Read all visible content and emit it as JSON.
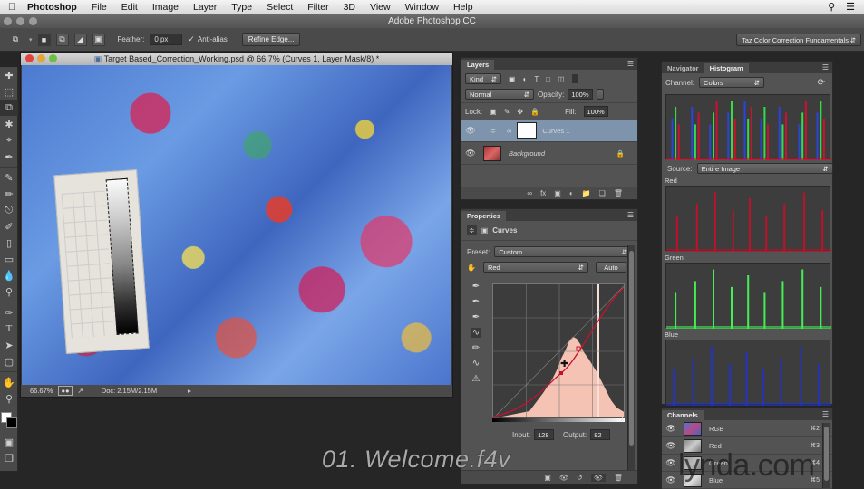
{
  "menubar": {
    "app": "Photoshop",
    "items": [
      "File",
      "Edit",
      "Image",
      "Layer",
      "Type",
      "Select",
      "Filter",
      "3D",
      "View",
      "Window",
      "Help"
    ]
  },
  "app_title": "Adobe Photoshop CC",
  "options_bar": {
    "feather_label": "Feather:",
    "feather_value": "0 px",
    "antialias_label": "Anti-alias",
    "antialias_checked": true,
    "refine_edge_label": "Refine Edge...",
    "workspace": "Taz Color Correction Fundamentals"
  },
  "tools": [
    "move",
    "marquee",
    "lasso",
    "quick-select",
    "crop",
    "eyedropper",
    "spot-heal",
    "brush",
    "clone-stamp",
    "history-brush",
    "eraser",
    "gradient",
    "blur",
    "dodge",
    "pen",
    "type",
    "path-select",
    "rectangle",
    "hand",
    "zoom"
  ],
  "document": {
    "title": "Target Based_Correction_Working.psd @ 66.7% (Curves 1, Layer Mask/8) *",
    "zoom": "66.67%",
    "doc_size": "Doc: 2.15M/2.15M"
  },
  "layers_panel": {
    "tab": "Layers",
    "filter_kind": "Kind",
    "blend_mode": "Normal",
    "opacity_label": "Opacity:",
    "opacity": "100%",
    "lock_label": "Lock:",
    "fill_label": "Fill:",
    "fill": "100%",
    "layers": [
      {
        "name": "Curves 1",
        "selected": true,
        "visible": true
      },
      {
        "name": "Background",
        "selected": false,
        "visible": true,
        "locked": true
      }
    ]
  },
  "properties_panel": {
    "tab": "Properties",
    "title": "Curves",
    "preset_label": "Preset:",
    "preset": "Custom",
    "channel": "Red",
    "auto_label": "Auto",
    "input_label": "Input:",
    "input": "128",
    "output_label": "Output:",
    "output": "82"
  },
  "histogram_panel": {
    "tabs": [
      "Navigator",
      "Histogram"
    ],
    "active_tab": "Histogram",
    "channel_label": "Channel:",
    "channel": "Colors",
    "source_label": "Source:",
    "source": "Entire Image",
    "sub_labels": [
      "Red",
      "Green",
      "Blue"
    ]
  },
  "channels_panel": {
    "tab": "Channels",
    "channels": [
      {
        "name": "RGB",
        "shortcut": "⌘2"
      },
      {
        "name": "Red",
        "shortcut": "⌘3"
      },
      {
        "name": "Green",
        "shortcut": "⌘4"
      },
      {
        "name": "Blue",
        "shortcut": "⌘5"
      }
    ]
  },
  "overlay": {
    "video_title": "01. Welcome.f4v",
    "watermark": "lynda.com"
  }
}
